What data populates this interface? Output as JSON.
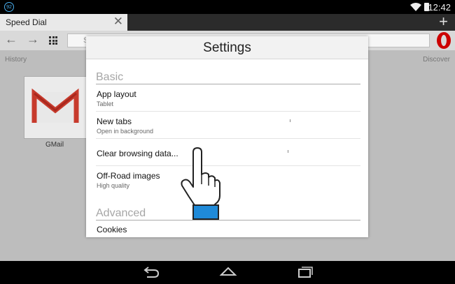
{
  "status_bar": {
    "notification_badge": "92",
    "time": "12:42"
  },
  "browser": {
    "tab": {
      "title": "Speed Dial",
      "close_icon": "close-icon"
    },
    "new_tab_icon": "plus-icon",
    "toolbar": {
      "back_icon": "arrow-left-icon",
      "forward_icon": "arrow-right-icon",
      "speed_dial_icon": "grid-icon",
      "address_placeholder": "S",
      "menu_icon": "opera-logo-icon"
    }
  },
  "speed_dial": {
    "history_label": "History",
    "discover_label": "Discover",
    "tiles": [
      {
        "label": "GMail",
        "icon": "gmail-logo"
      }
    ]
  },
  "settings_dialog": {
    "title": "Settings",
    "sections": [
      {
        "heading": "Basic",
        "items": [
          {
            "title": "App layout",
            "subtitle": "Tablet"
          },
          {
            "title": "New tabs",
            "subtitle": "Open in background"
          },
          {
            "title": "Clear browsing data...",
            "subtitle": ""
          },
          {
            "title": "Off-Road images",
            "subtitle": "High quality"
          }
        ]
      },
      {
        "heading": "Advanced",
        "items": [
          {
            "title": "Cookies",
            "subtitle": ""
          }
        ]
      }
    ]
  },
  "nav_bar": {
    "back_icon": "back-icon",
    "home_icon": "home-icon",
    "recents_icon": "recent-apps-icon"
  },
  "colors": {
    "hand_cuff": "#1f8ad8",
    "status_icon": "#4ab0f0",
    "opera_red": "#cc0000"
  }
}
